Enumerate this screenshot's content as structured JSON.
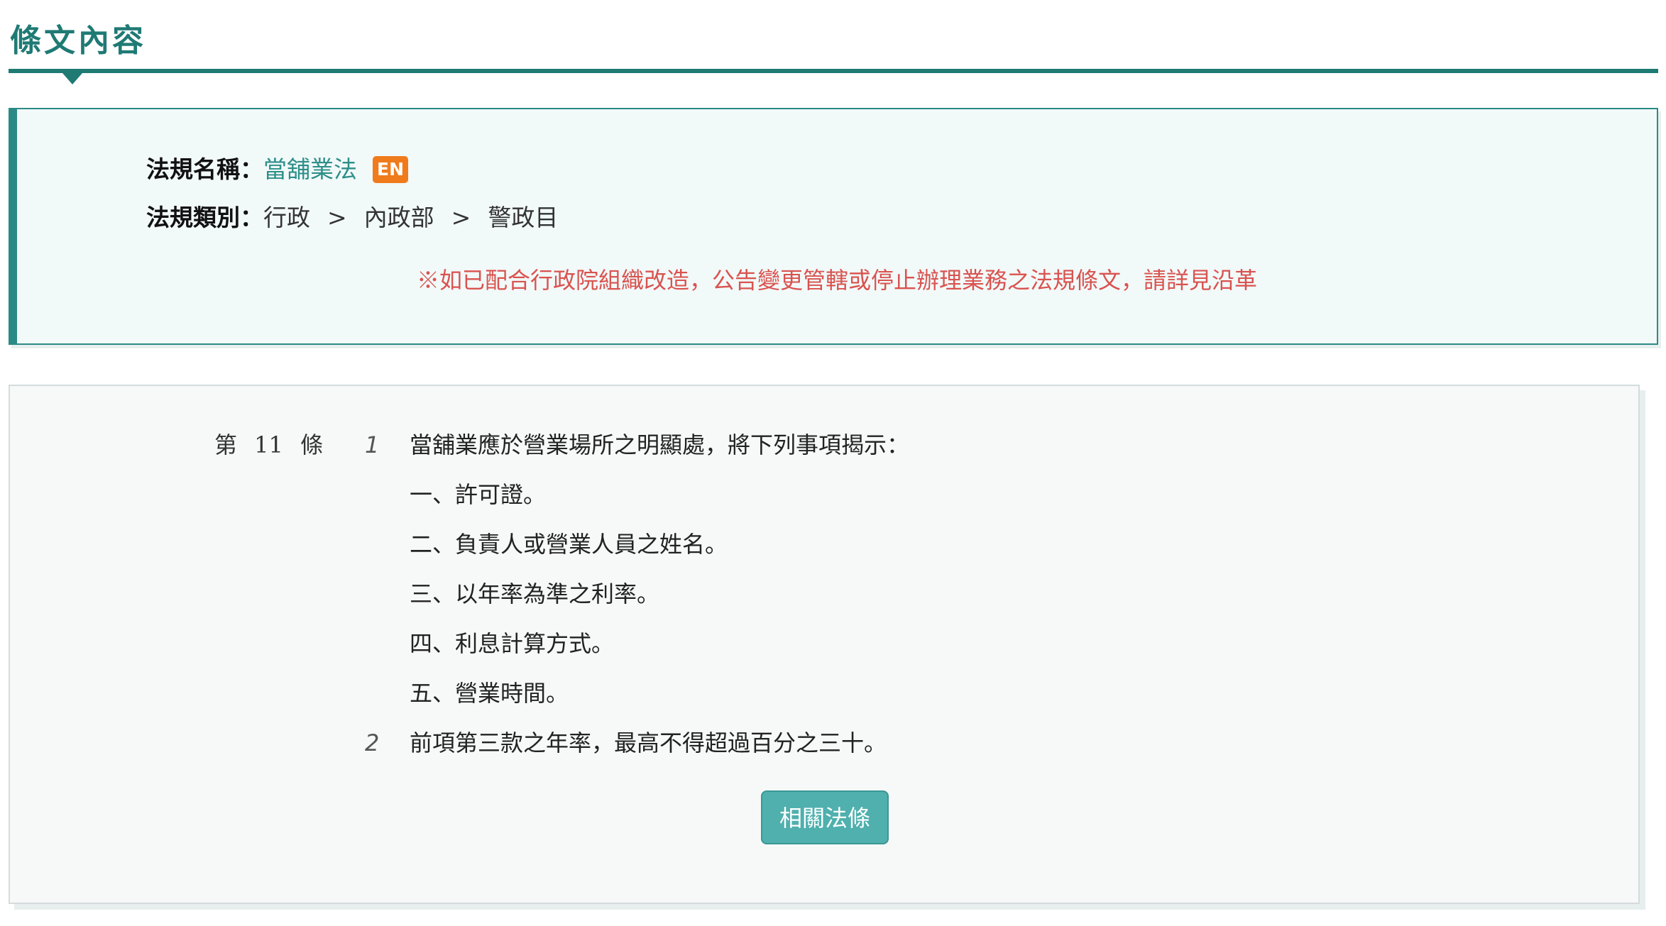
{
  "header": {
    "title": "條文內容"
  },
  "info": {
    "law_name_label": "法規名稱：",
    "law_name": "當舖業法",
    "en_badge": "EN",
    "category_label": "法規類別：",
    "categories": [
      "行政",
      "內政部",
      "警政目"
    ],
    "category_separator": ">",
    "note": "※如已配合行政院組織改造，公告變更管轄或停止辦理業務之法規條文，請詳見沿革"
  },
  "article": {
    "number_label": "第 11 條",
    "paragraphs": [
      {
        "num": "1",
        "lines": [
          "當舖業應於營業場所之明顯處，將下列事項揭示：",
          "一、許可證。",
          "二、負責人或營業人員之姓名。",
          "三、以年率為準之利率。",
          "四、利息計算方式。",
          "五、營業時間。"
        ]
      },
      {
        "num": "2",
        "lines": [
          "前項第三款之年率，最高不得超過百分之三十。"
        ]
      }
    ],
    "related_button": "相關法條"
  },
  "colors": {
    "primary": "#1f7a74",
    "link": "#2e8f89",
    "badge": "#f07b1c",
    "note": "#d9534f",
    "button": "#4fb0ae"
  }
}
